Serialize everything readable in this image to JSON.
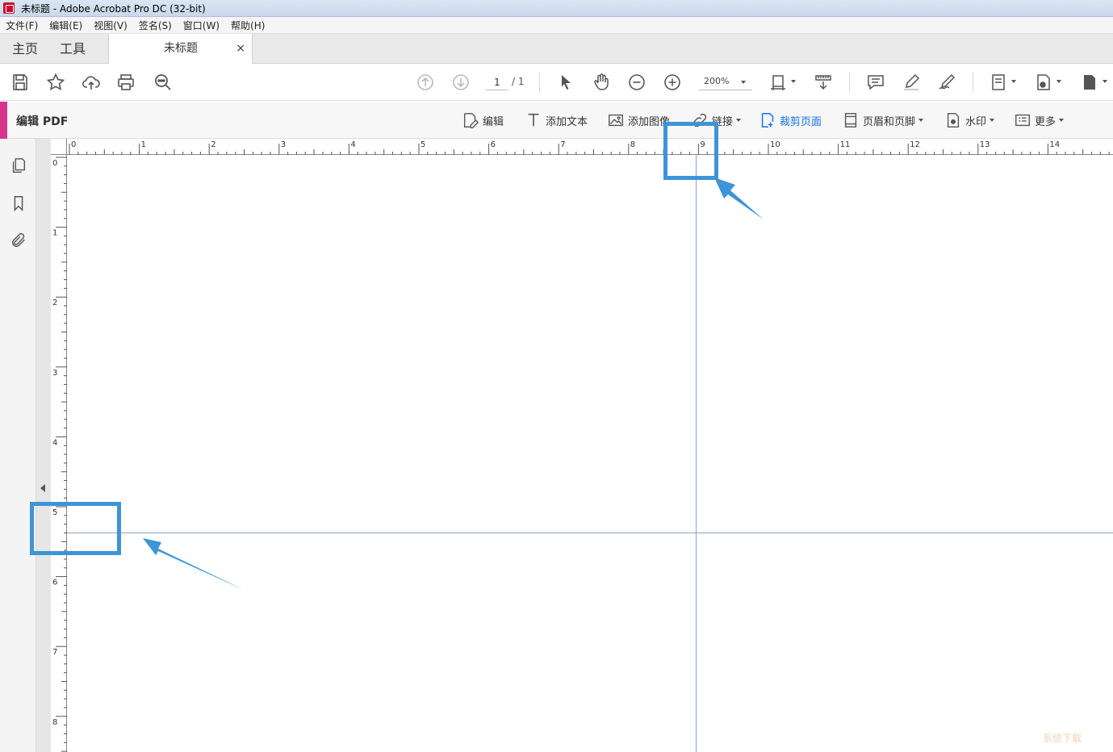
{
  "window": {
    "title": "未标题 - Adobe Acrobat Pro DC (32-bit)"
  },
  "menu": [
    "文件(F)",
    "编辑(E)",
    "视图(V)",
    "签名(S)",
    "窗口(W)",
    "帮助(H)"
  ],
  "tabs": {
    "home": "主页",
    "tools": "工具",
    "document": "未标题",
    "close": "×"
  },
  "toolbar": {
    "page_current": "1",
    "page_total": "/ 1",
    "zoom": "200%"
  },
  "edit_bar": {
    "title": "编辑 PDF",
    "tools": {
      "edit": "编辑",
      "add_text": "添加文本",
      "add_image": "添加图像",
      "link": "链接",
      "crop": "裁剪页面",
      "header_footer": "页眉和页脚",
      "watermark": "水印",
      "more": "更多"
    }
  },
  "rulers": {
    "horizontal": [
      "0",
      "1",
      "2",
      "3",
      "4",
      "5",
      "6",
      "7",
      "8",
      "9",
      "10",
      "11",
      "12",
      "13",
      "14"
    ],
    "vertical": [
      "0",
      "1",
      "2",
      "3",
      "4",
      "5",
      "6",
      "7",
      "8"
    ]
  },
  "guides": {
    "vertical_at": 9,
    "horizontal_at": 5.4
  },
  "colors": {
    "accent_pink": "#d9358c",
    "guide": "#8f9fcf",
    "annotation_blue": "#3d94d6",
    "active_blue": "#1473e6"
  },
  "watermark": "系统下载"
}
